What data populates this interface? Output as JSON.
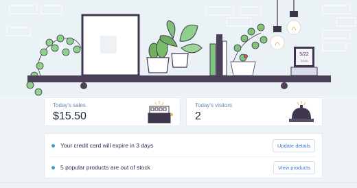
{
  "calendar": {
    "date": "5/22",
    "year": "2016"
  },
  "plant_pot_label": "",
  "stats": [
    {
      "label": "Today's sales",
      "value": "$15.50"
    },
    {
      "label": "Today's visitors",
      "value": "2"
    }
  ],
  "tasks": [
    {
      "text": "Your credit card will expire in 3 days",
      "button": "Update details"
    },
    {
      "text": "5 popular products are out of stock",
      "button": "View products"
    }
  ],
  "colors": {
    "shelf": "#4c4058",
    "accent": "#3e9bd6",
    "leaf": "#7fc47a"
  },
  "icons": [
    "cash-register-icon",
    "service-bell-icon",
    "hanging-lamp-icon",
    "calendar-icon",
    "cactus-icon",
    "plant-icon"
  ]
}
